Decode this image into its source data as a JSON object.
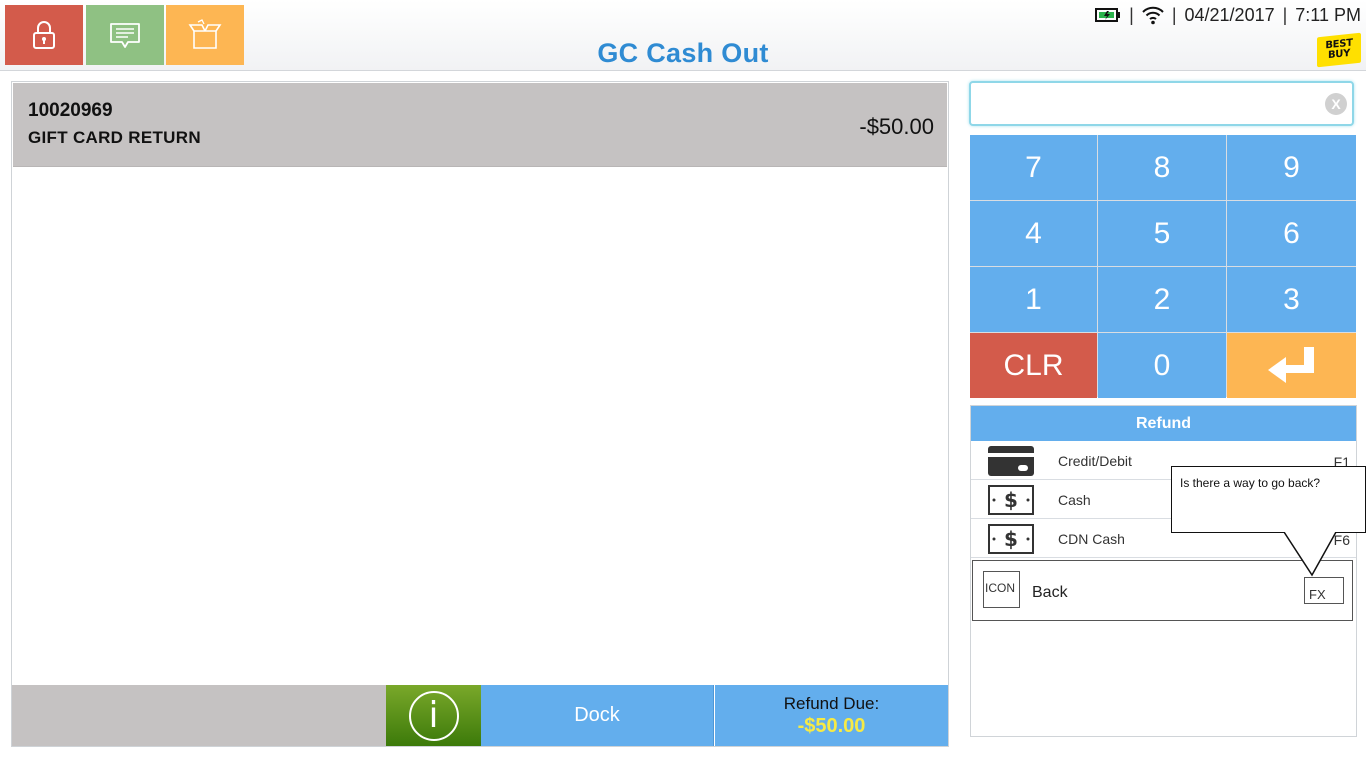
{
  "header": {
    "title": "GC Cash Out",
    "date": "04/21/2017",
    "time": "7:11 PM",
    "separator": "|",
    "logo_lines": [
      "BEST",
      "BUY"
    ],
    "tiles": [
      {
        "icon": "lock-icon",
        "color": "#d35b4b"
      },
      {
        "icon": "message-icon",
        "color": "#8fc183"
      },
      {
        "icon": "open-box-icon",
        "color": "#fdb653"
      }
    ]
  },
  "transaction": {
    "items": [
      {
        "sku": "10020969",
        "description": "GIFT CARD RETURN",
        "price": "-$50.00"
      }
    ],
    "footer": {
      "info_label": "i",
      "dock_label": "Dock",
      "refund_due_label": "Refund Due:",
      "refund_due_amount": "-$50.00"
    }
  },
  "entry": {
    "value": "",
    "clear_label": "X"
  },
  "keypad": {
    "keys": [
      "7",
      "8",
      "9",
      "4",
      "5",
      "6",
      "1",
      "2",
      "3",
      "CLR",
      "0"
    ],
    "enter_icon": "enter-arrow-icon"
  },
  "refund": {
    "title": "Refund",
    "options": [
      {
        "label": "Credit/Debit",
        "key": "F1",
        "icon": "credit-card-icon"
      },
      {
        "label": "Cash",
        "key": "",
        "icon": "cash-icon"
      },
      {
        "label": "CDN Cash",
        "key": "F6",
        "icon": "cash-icon"
      }
    ],
    "back": {
      "icon_placeholder": "ICON",
      "label": "Back",
      "key_placeholder": "FX"
    }
  },
  "annotation": {
    "text": "Is there a way to go back?"
  },
  "colors": {
    "blue": "#63aeed",
    "red": "#d35b4b",
    "orange": "#fdb653",
    "green": "#8fc183",
    "title_blue": "#2f8bd3",
    "due_yellow": "#f6ea45"
  }
}
